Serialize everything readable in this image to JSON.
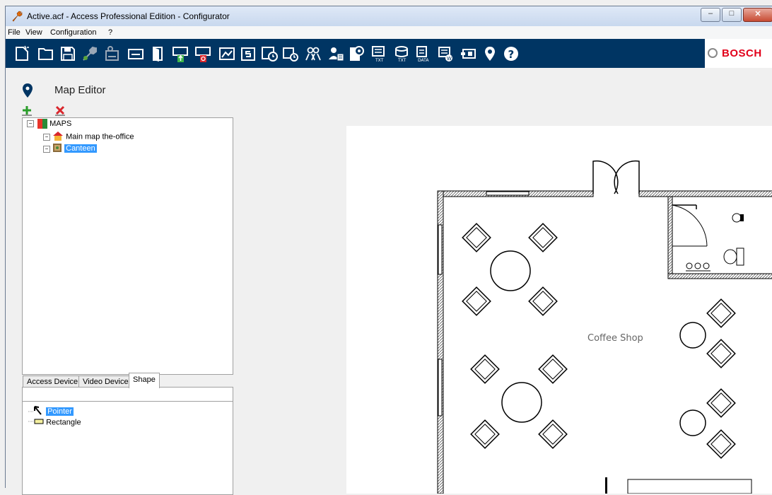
{
  "window": {
    "title": "Active.acf - Access Professional Edition - Configurator",
    "controls": {
      "minimize": "–",
      "maximize": "□",
      "close": "✕"
    }
  },
  "menu": {
    "items": [
      "File",
      "View",
      "Configuration",
      "?"
    ]
  },
  "toolbar": {
    "icons": [
      "new-icon",
      "open-folder-icon",
      "save-icon",
      "wrench-icon",
      "configure-device-icon",
      "card-reader-icon",
      "door-icon",
      "arrival-icon",
      "departure-icon",
      "area-icon",
      "special-day-icon",
      "time-model-icon",
      "day-model-icon",
      "personnel-group-icon",
      "visitor-icon",
      "card-definition-icon",
      "text-report-icon",
      "database-report-icon",
      "data-report-icon",
      "web-icon",
      "badge-icon",
      "map-pin-icon",
      "help-icon"
    ],
    "brand": "BOSCH",
    "brand_color": "#e2001a",
    "background": "#003563"
  },
  "page": {
    "title": "Map Editor"
  },
  "tree": {
    "root": "MAPS",
    "items": [
      "Main map the-office",
      "Canteen"
    ],
    "selected": "Canteen"
  },
  "tabs": {
    "items": [
      "Access Device",
      "Video Device",
      "Shape"
    ],
    "active": "Shape"
  },
  "shapes": {
    "items": [
      "Pointer",
      "Rectangle"
    ],
    "selected": "Pointer"
  },
  "map": {
    "room_label": "Coffee Shop"
  }
}
